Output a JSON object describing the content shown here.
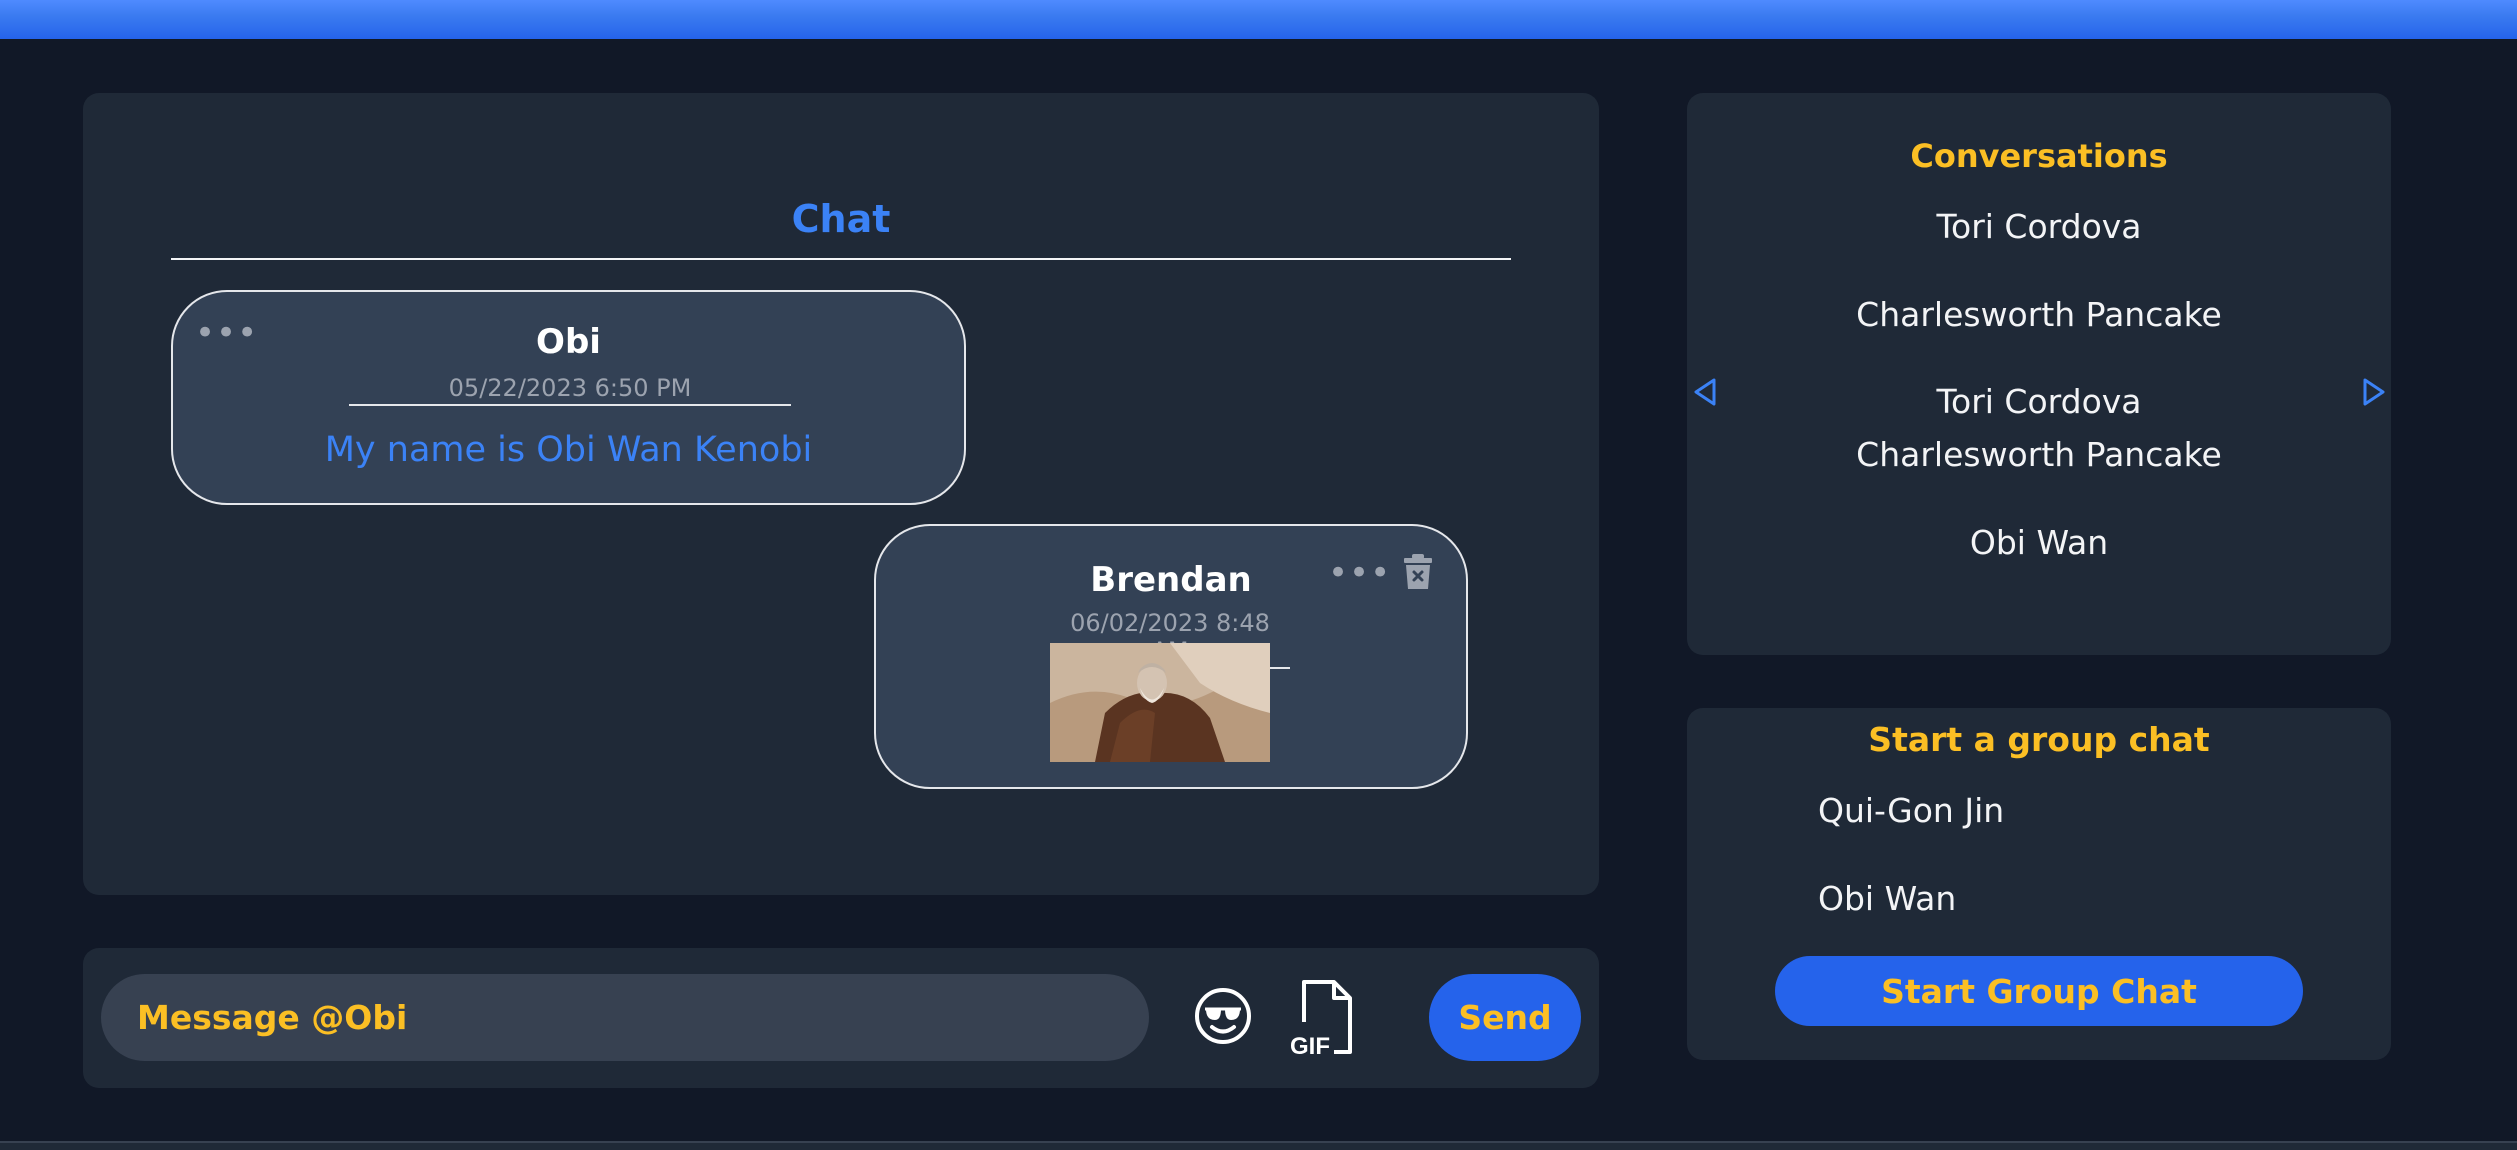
{
  "chat": {
    "title": "Chat",
    "messages": [
      {
        "sender": "Obi",
        "timestamp": "05/22/2023 6:50 PM",
        "text": "My name is Obi Wan Kenobi"
      },
      {
        "sender": "Brendan",
        "timestamp": "06/02/2023 8:48 AM",
        "image": "obi-wan-gif"
      }
    ]
  },
  "composer": {
    "placeholder": "Message @Obi",
    "emoji_icon": "sunglasses-emoji-icon",
    "gif_icon": "gif-file-icon",
    "gif_label": "GIF",
    "send_label": "Send"
  },
  "conversations": {
    "title": "Conversations",
    "items": [
      "Tori Cordova",
      "Charlesworth Pancake",
      "Tori Cordova",
      "Charlesworth Pancake",
      "Obi Wan"
    ],
    "prev_icon": "triangle-left-icon",
    "next_icon": "triangle-right-icon"
  },
  "group_chat": {
    "title": "Start a group chat",
    "users": [
      "Qui-Gon Jin",
      "Obi Wan"
    ],
    "button_label": "Start Group Chat"
  },
  "colors": {
    "background": "#111827",
    "panel": "#1f2937",
    "bubble": "#334155",
    "accent_blue": "#3b82f6",
    "button_blue": "#2563eb",
    "accent_yellow": "#fbbf24"
  }
}
